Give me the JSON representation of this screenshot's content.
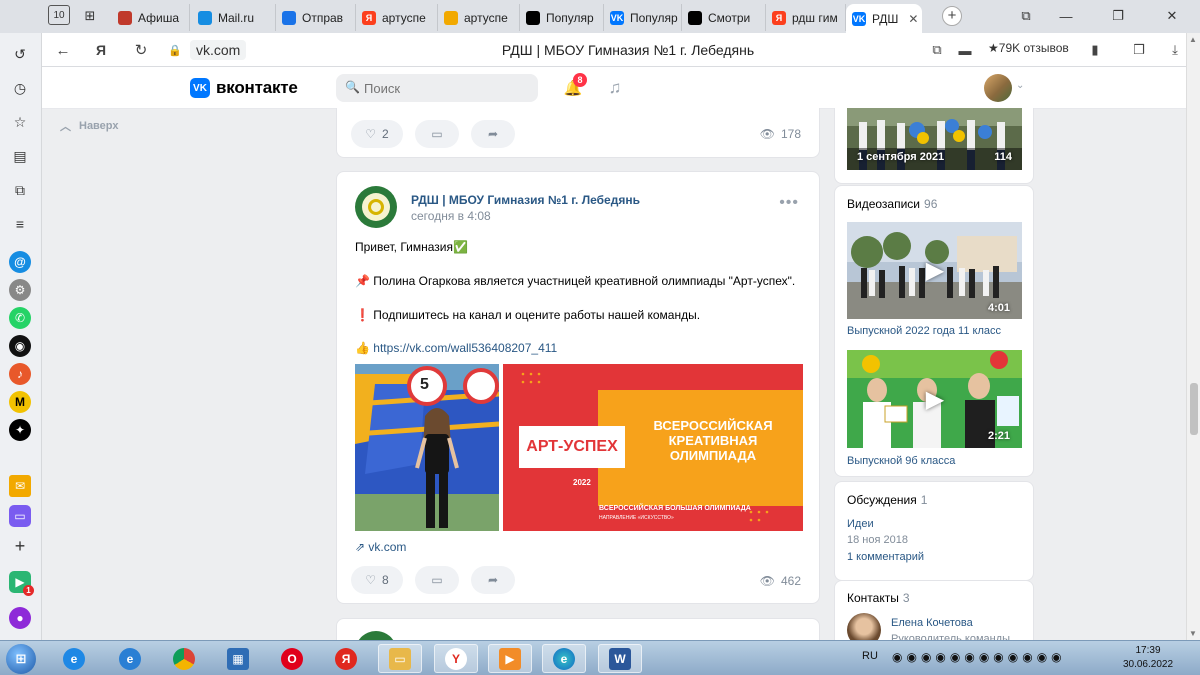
{
  "browser": {
    "tabs": [
      {
        "label": "Афиша",
        "icon": "calendar-icon",
        "color": "#c0392b"
      },
      {
        "label": "Mail.ru",
        "icon": "mailru-icon",
        "color": "#168de2"
      },
      {
        "label": "Отправ",
        "icon": "mail-icon",
        "color": "#1a73e8"
      },
      {
        "label": "артуспе",
        "icon": "yandex-icon",
        "color": "#fc3f1d"
      },
      {
        "label": "артуспе",
        "icon": "image-icon",
        "color": "#f2a900"
      },
      {
        "label": "Популяр",
        "icon": "zen-icon",
        "color": "#000000"
      },
      {
        "label": "Популяр",
        "icon": "vk-icon",
        "color": "#0077ff"
      },
      {
        "label": "Смотри",
        "icon": "zen-icon",
        "color": "#000000"
      },
      {
        "label": "рдш гим",
        "icon": "yandex-icon",
        "color": "#fc3f1d"
      },
      {
        "label": "РДШ",
        "icon": "vk-icon",
        "color": "#0077ff",
        "active": true
      }
    ],
    "tab_count": "10",
    "address": "vk.com",
    "page_title": "РДШ | МБОУ Гимназия №1 г. Лебедянь",
    "reviews": "79K отзывов"
  },
  "vk": {
    "logo_text": "вконтакте",
    "search_placeholder": "Поиск",
    "notifications_count": "8",
    "back_label": "Наверх"
  },
  "feed": {
    "prev_post": {
      "likes": "2",
      "views": "178"
    },
    "post": {
      "author": "РДШ | МБОУ Гимназия №1 г. Лебедянь",
      "time": "сегодня в 4:08",
      "lines": [
        {
          "icon": "",
          "text": "Привет, Гимназия✅"
        },
        {
          "icon": "📌",
          "text": "Полина Огаркова является участницей креативной олимпиады \"Арт-успех\"."
        },
        {
          "icon": "❗",
          "text": "Подпишитесь на канал и оцените работы нашей команды."
        }
      ],
      "link_icon": "👍",
      "link": "https://vk.com/wall536408207_411",
      "banner": {
        "brand": "АРТ-УСПЕХ",
        "headline": [
          "ВСЕРОССИЙСКАЯ",
          "КРЕАТИВНАЯ",
          "ОЛИМПИАДА"
        ],
        "year": "2022",
        "sub": "ВСЕРОССИЙСКАЯ БОЛЬШАЯ ОЛИМПИАДА",
        "sub2": "НАПРАВЛЕНИЕ «ИСКУССТВО»"
      },
      "sign_number": "5",
      "snippet": "vk.com",
      "likes": "8",
      "views": "462"
    }
  },
  "sidebar": {
    "album": {
      "title": "1 сентября 2021",
      "count": "114"
    },
    "videos": {
      "title": "Видеозаписи",
      "count": "96",
      "items": [
        {
          "title": "Выпускной 2022 года 11 класс",
          "duration": "4:01"
        },
        {
          "title": "Выпускной 9б класса",
          "duration": "2:21"
        }
      ]
    },
    "discussions": {
      "title": "Обсуждения",
      "count": "1",
      "topic": "Идеи",
      "date": "18 ноя 2018",
      "comments": "1 комментарий"
    },
    "contacts": {
      "title": "Контакты",
      "count": "3",
      "name": "Елена Кочетова",
      "role": "Руководитель команды"
    }
  },
  "taskbar": {
    "lang": "RU",
    "time": "17:39",
    "date": "30.06.2022"
  },
  "colors": {
    "vk_blue": "#0077ff",
    "link": "#2a5885",
    "banner_red": "#e23538",
    "banner_orange": "#f7a21b"
  }
}
